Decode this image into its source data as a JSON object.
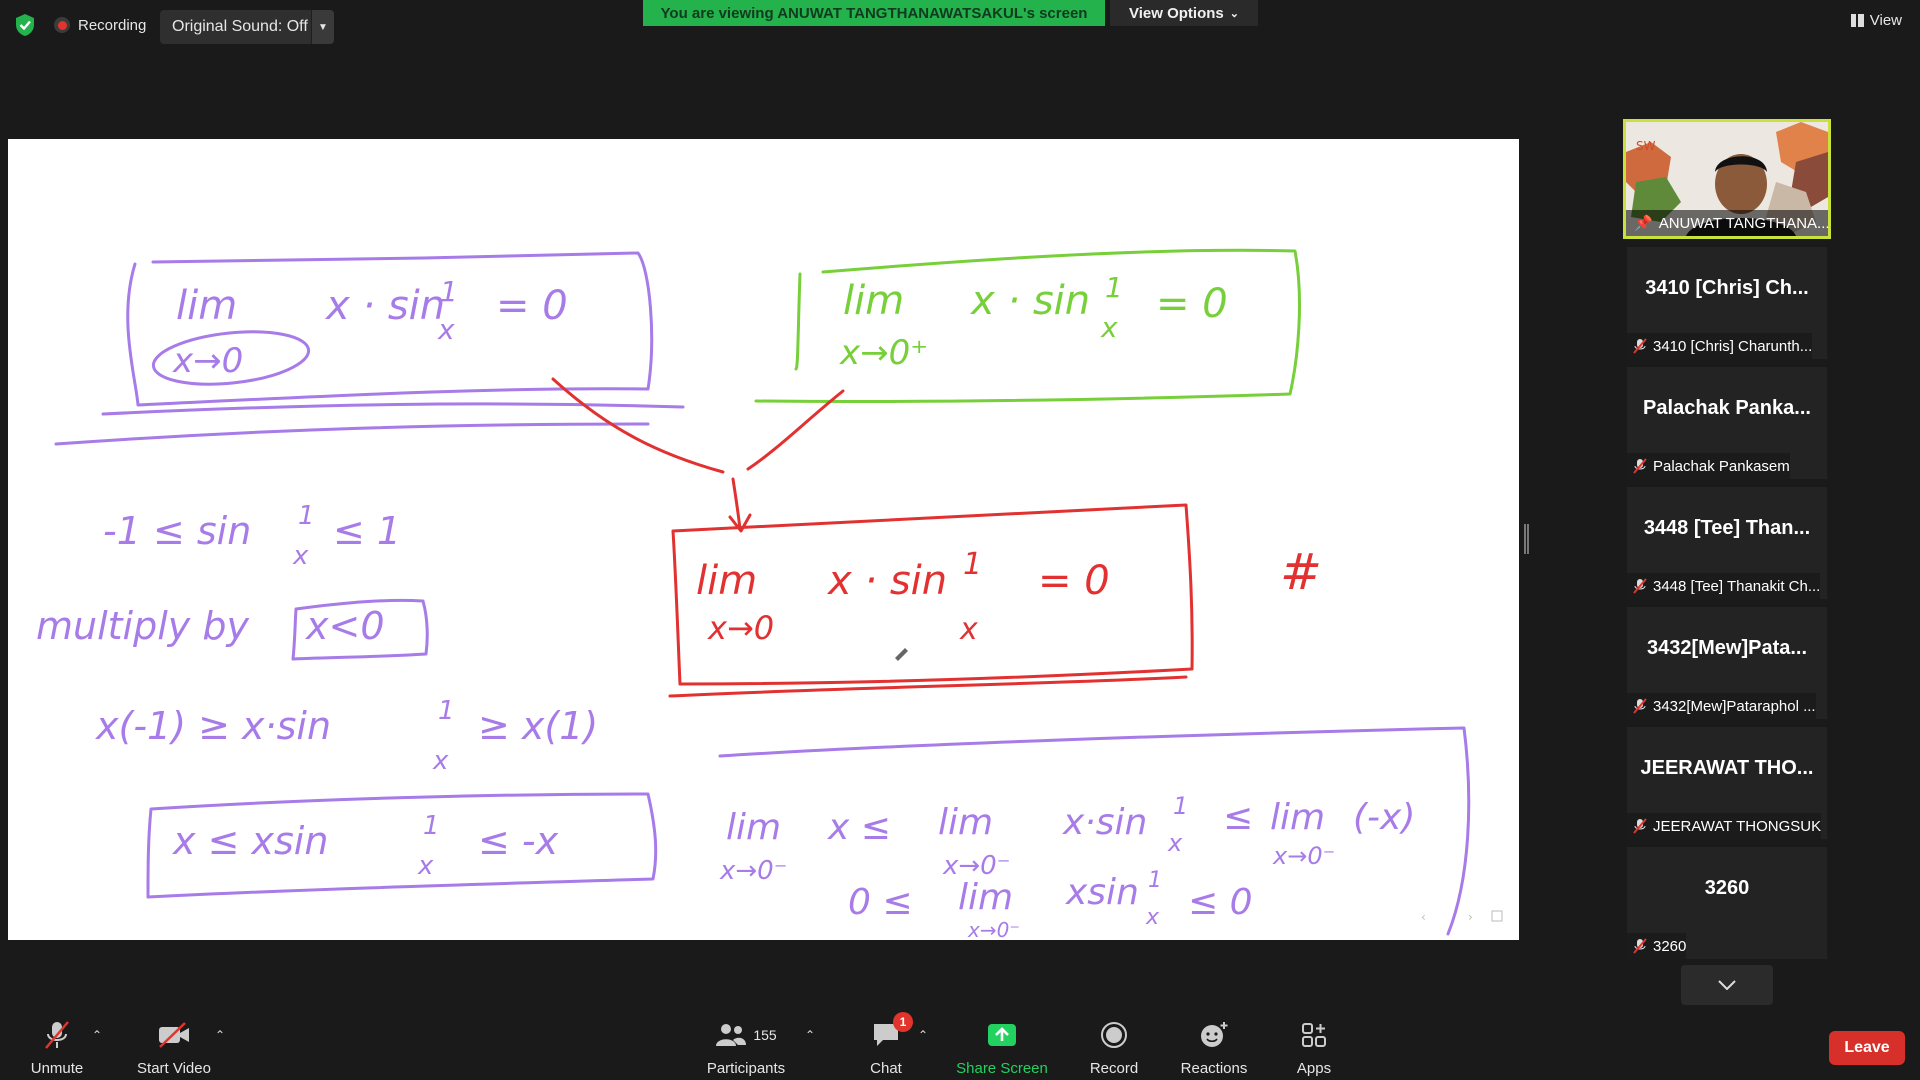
{
  "topbar": {
    "recording_label": "Recording",
    "original_sound": "Original Sound: Off",
    "viewing_banner": "You are viewing ANUWAT TANGTHANAWATSAKUL's screen",
    "view_options": "View Options",
    "view_label": "View"
  },
  "colors": {
    "banner_green": "#23b24b",
    "leave_red": "#d7302b",
    "active_speaker_border": "#c9e23b",
    "share_green": "#23d160"
  },
  "whiteboard": {
    "purple_box1": {
      "lim": "lim",
      "sub": "x→0",
      "expr": "x · sin",
      "frac_num": "1",
      "frac_den": "x",
      "eq": "= 0"
    },
    "green_box": {
      "lim": "lim",
      "sub": "x→0⁺",
      "expr": "x · sin",
      "frac_num": "1",
      "frac_den": "x",
      "eq": "= 0"
    },
    "red_box": {
      "lim": "lim",
      "sub": "x→0",
      "expr": "x · sin",
      "frac_num": "1",
      "frac_den": "x",
      "eq": "= 0"
    },
    "hash": "#",
    "ineq1": {
      "left": "-1 ≤ sin",
      "num": "1",
      "den": "x",
      "right": "≤ 1"
    },
    "multiply": {
      "text": "multiply  by",
      "boxed": "x<0"
    },
    "ineq2": {
      "left": "x(-1) ≥  x·sin",
      "num": "1",
      "den": "x",
      "right": "≥ x(1)"
    },
    "ineq3": {
      "left": "x ≤   xsin",
      "num": "1",
      "den": "x",
      "right": "≤ -x"
    },
    "limline1": {
      "lim1": "lim",
      "sub1": "x→0⁻",
      "x": "x  ≤",
      "lim2": "lim",
      "sub2": "x→0⁻",
      "expr": "x·sin",
      "num": "1",
      "den": "x",
      "le": "≤",
      "lim3": "lim",
      "sub3": "x→0⁻",
      "neg": "(-x)"
    },
    "limline2": {
      "zero": "0  ≤",
      "lim": "lim",
      "sub": "x→0⁻",
      "expr": "xsin",
      "num": "1",
      "den": "x",
      "right": "≤   0"
    }
  },
  "participants_panel": {
    "self": {
      "name": "ANUWAT TANGTHANA..."
    },
    "tiles": [
      {
        "big": "3410 [Chris] Ch...",
        "small": "3410 [Chris] Charunth..."
      },
      {
        "big": "Palachak Panka...",
        "small": "Palachak Pankasem"
      },
      {
        "big": "3448 [Tee] Than...",
        "small": "3448 [Tee] Thanakit Ch..."
      },
      {
        "big": "3432[Mew]Pata...",
        "small": "3432[Mew]Pataraphol ..."
      },
      {
        "big": "JEERAWAT THO...",
        "small": "JEERAWAT THONGSUK"
      },
      {
        "big": "3260",
        "small": "3260"
      }
    ]
  },
  "toolbar": {
    "unmute": "Unmute",
    "start_video": "Start Video",
    "participants_count": "155",
    "participants": "Participants",
    "chat": "Chat",
    "chat_badge": "1",
    "share_screen": "Share Screen",
    "record": "Record",
    "reactions": "Reactions",
    "apps": "Apps",
    "leave": "Leave"
  }
}
